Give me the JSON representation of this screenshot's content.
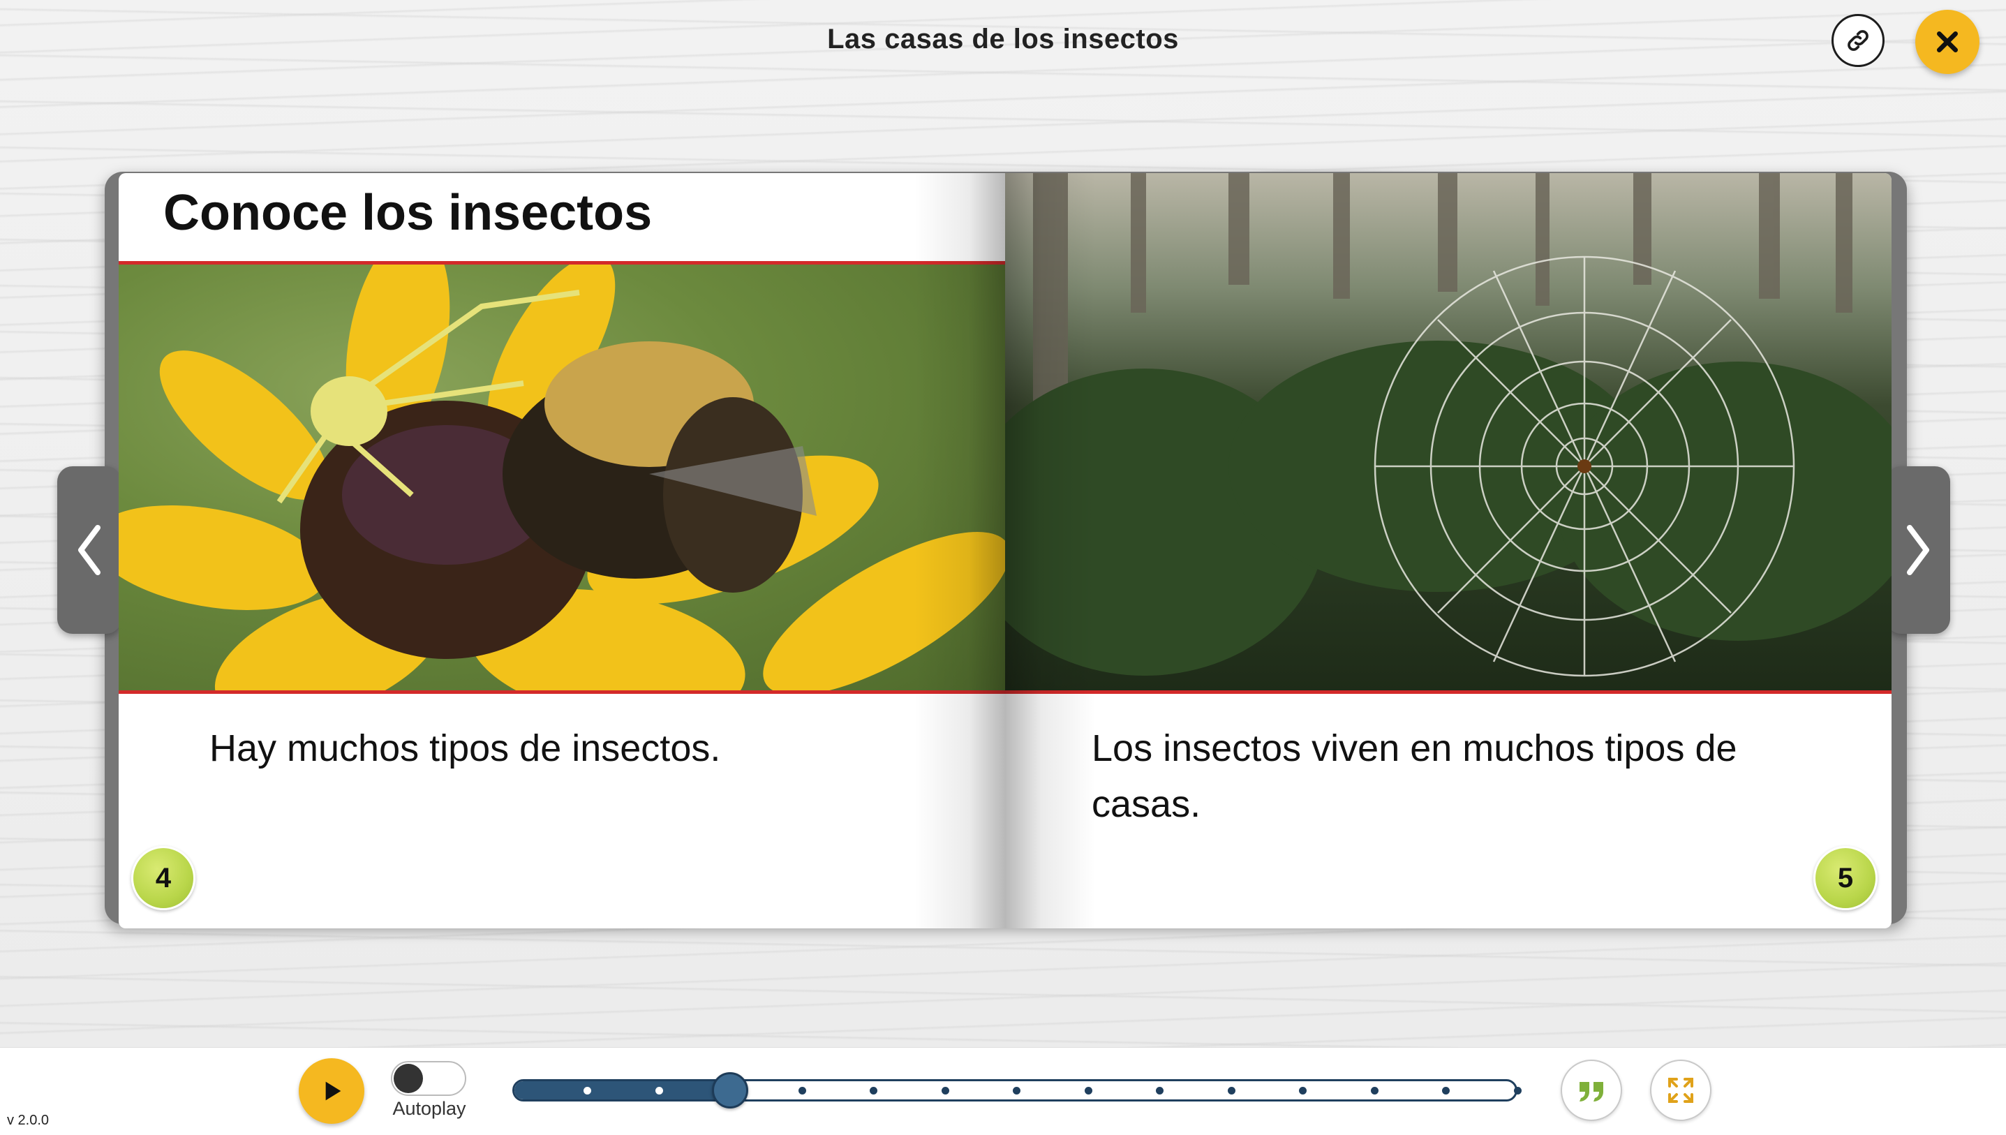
{
  "header": {
    "title": "Las casas de los insectos"
  },
  "icons": {
    "link": "link-icon",
    "close": "close-icon",
    "prev": "chevron-left-icon",
    "next": "chevron-right-icon",
    "play": "play-icon",
    "quote": "quote-icon",
    "expand": "expand-icon"
  },
  "book": {
    "left_page": {
      "heading": "Conoce los insectos",
      "text": "Hay muchos tipos de insectos.",
      "page_number": "4"
    },
    "right_page": {
      "text": "Los insectos viven en muchos tipos de casas.",
      "page_number": "5"
    }
  },
  "player": {
    "autoplay_label": "Autoplay",
    "autoplay_on": false,
    "progress": {
      "total_pages": 14,
      "current_page": 3
    }
  },
  "footer": {
    "version": "v 2.0.0"
  },
  "colors": {
    "accent_yellow": "#f5b820",
    "progress_blue": "#2d5578",
    "page_number_green": "#b9d64a",
    "rule_red": "#d32a2a"
  }
}
